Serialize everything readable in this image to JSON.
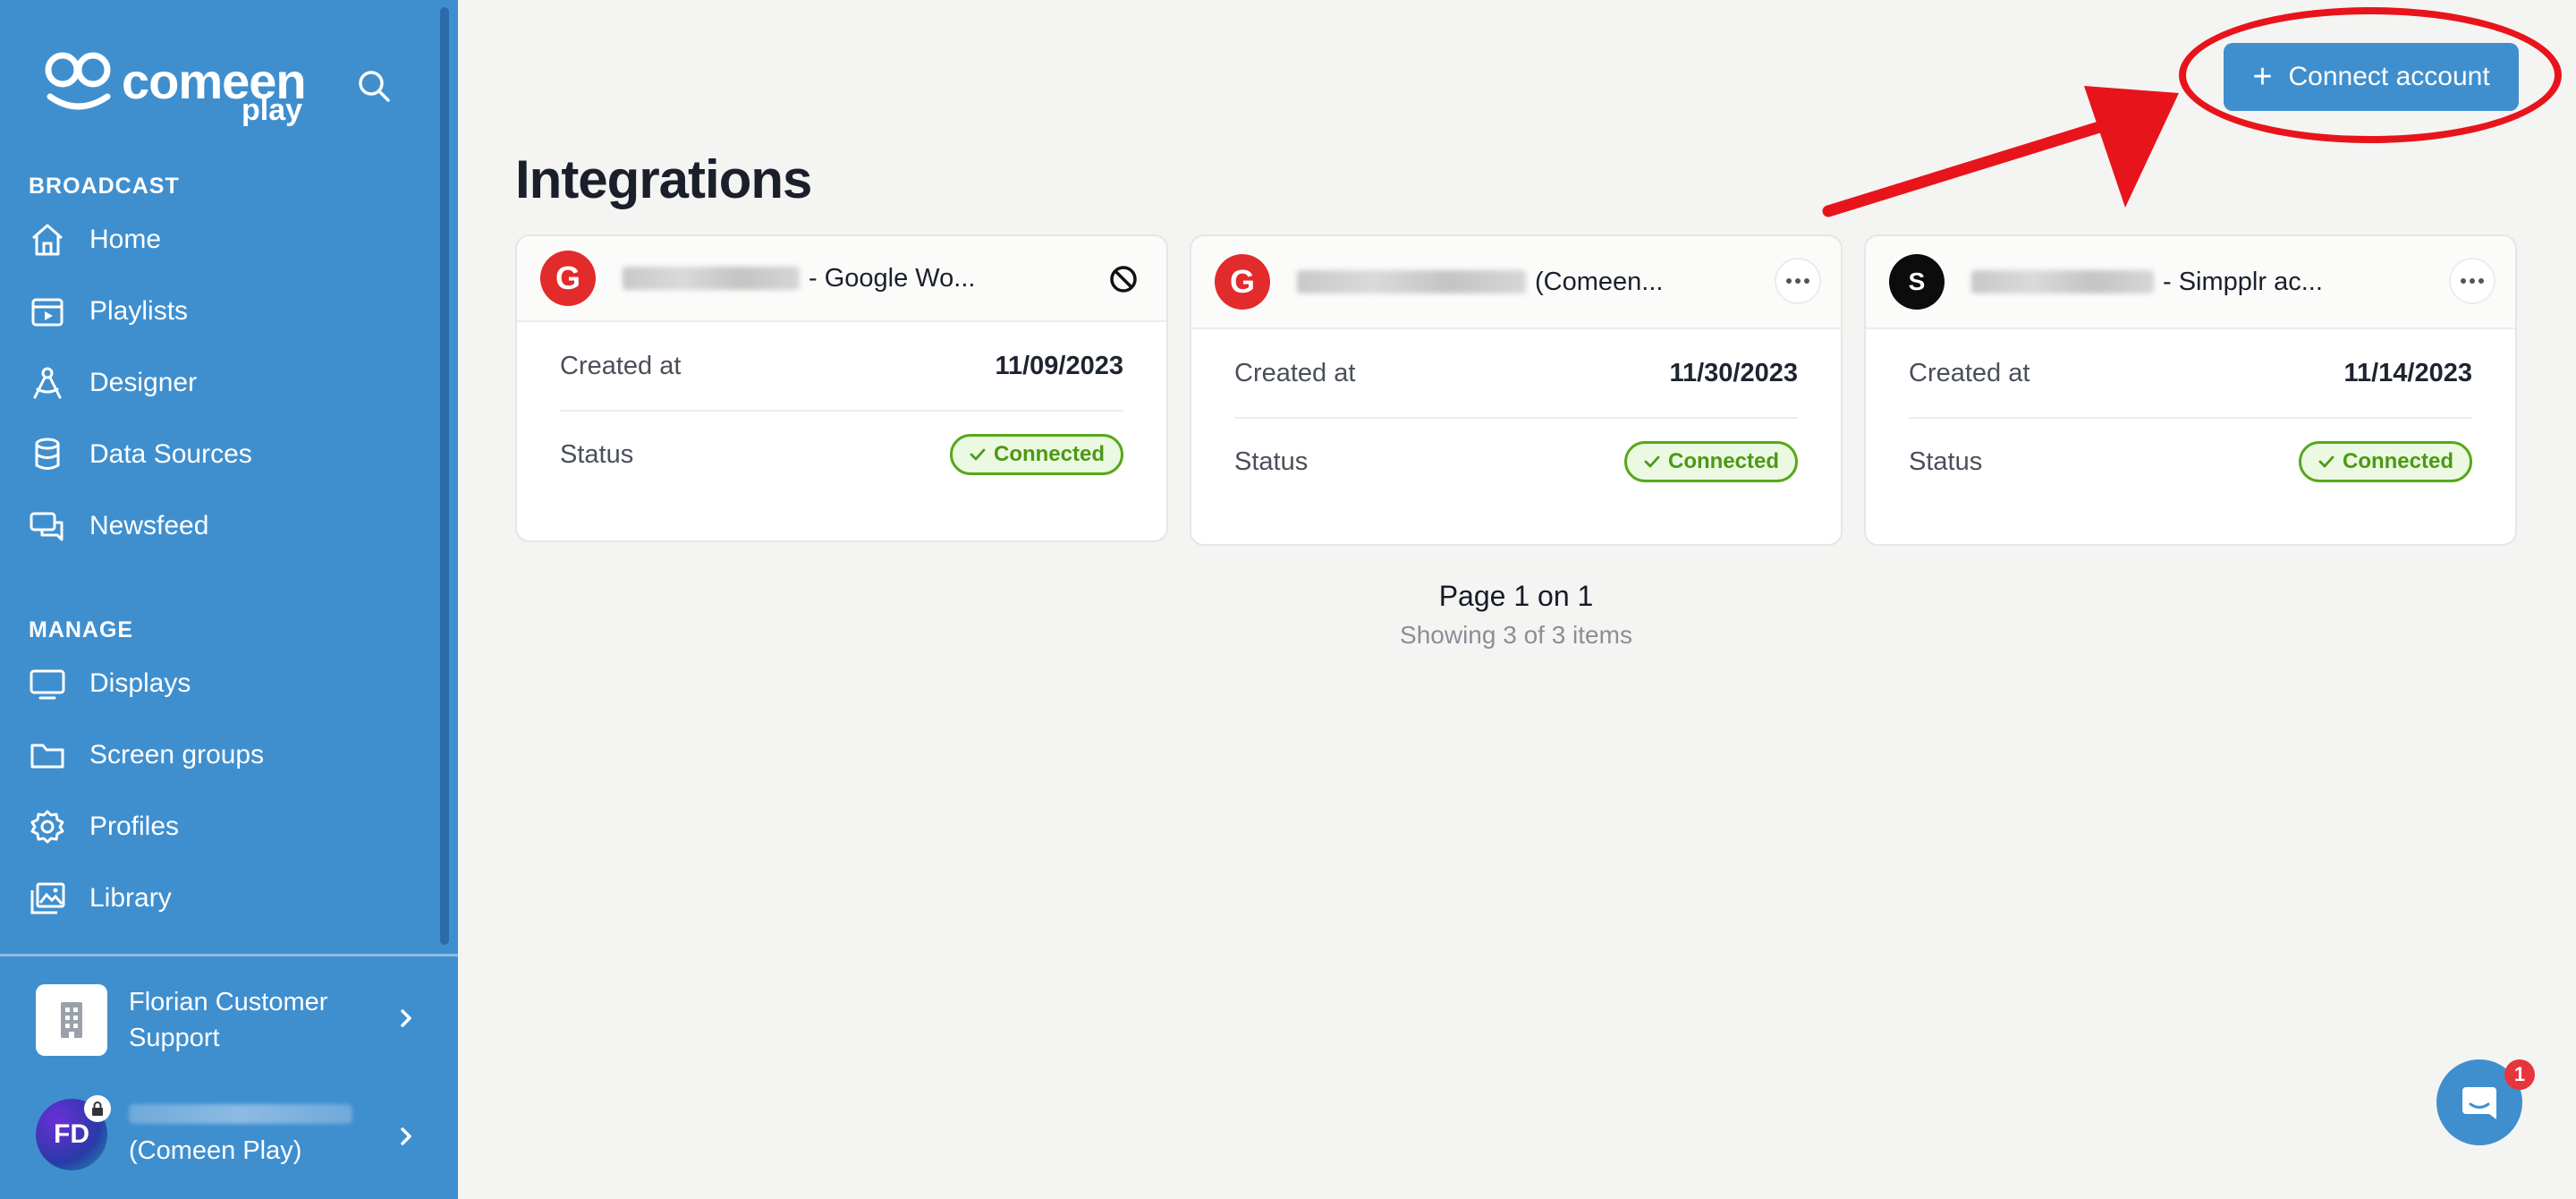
{
  "app": {
    "brand": "comeen",
    "brand_sub": "play"
  },
  "sidebar": {
    "sections": [
      {
        "label": "BROADCAST",
        "items": [
          {
            "label": "Home",
            "icon": "home-icon"
          },
          {
            "label": "Playlists",
            "icon": "playlist-icon"
          },
          {
            "label": "Designer",
            "icon": "designer-icon"
          },
          {
            "label": "Data Sources",
            "icon": "database-icon"
          },
          {
            "label": "Newsfeed",
            "icon": "newsfeed-icon"
          }
        ]
      },
      {
        "label": "MANAGE",
        "items": [
          {
            "label": "Displays",
            "icon": "monitor-icon"
          },
          {
            "label": "Screen groups",
            "icon": "folder-icon"
          },
          {
            "label": "Profiles",
            "icon": "gear-icon"
          },
          {
            "label": "Library",
            "icon": "image-library-icon"
          }
        ]
      }
    ],
    "organization": {
      "name": "Florian Customer Support"
    },
    "user": {
      "initials": "FD",
      "name": "(Comeen Play)"
    }
  },
  "header": {
    "connect_label": "Connect account"
  },
  "page": {
    "title": "Integrations"
  },
  "cards": [
    {
      "logo": "G",
      "title": "- Google Wo...",
      "created_label": "Created at",
      "created": "11/09/2023",
      "status_label": "Status",
      "status": "Connected"
    },
    {
      "logo": "G",
      "title": "(Comeen...",
      "created_label": "Created at",
      "created": "11/30/2023",
      "status_label": "Status",
      "status": "Connected"
    },
    {
      "logo": "S",
      "title": "- Simpplr ac...",
      "created_label": "Created at",
      "created": "11/14/2023",
      "status_label": "Status",
      "status": "Connected"
    }
  ],
  "pagination": {
    "page_text": "Page 1 on 1",
    "showing_text": "Showing 3 of 3 items"
  },
  "chat": {
    "badge_count": "1"
  },
  "colors": {
    "primary": "#3f8fcf",
    "success": "#56a81a",
    "annotation": "#e8141c",
    "google_red": "#e22b2b"
  }
}
